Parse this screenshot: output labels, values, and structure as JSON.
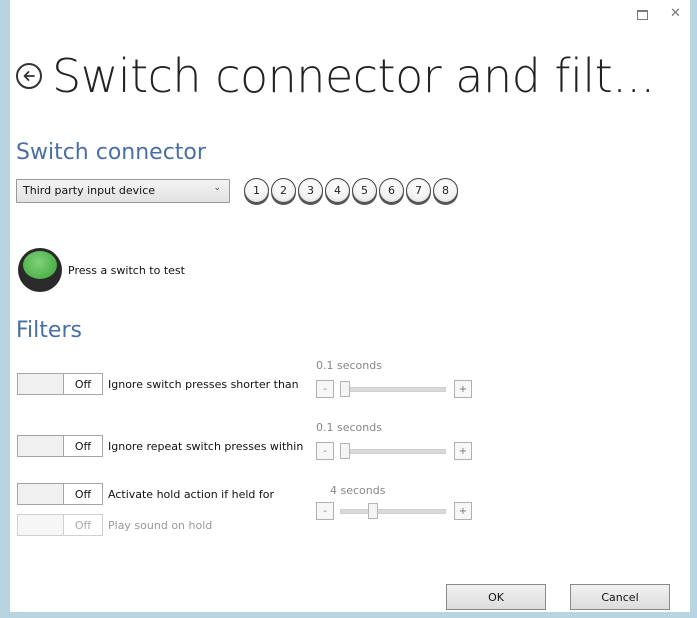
{
  "window": {
    "title": "Switch connector and filt...",
    "controls": {
      "maximize_icon": "maximize-icon",
      "close_icon": "close-icon",
      "close_glyph": "✕"
    }
  },
  "back_icon": "back-arrow-icon",
  "switch_connector": {
    "heading": "Switch connector",
    "device_select": {
      "selected": "Third party input device"
    },
    "numbers": [
      "1",
      "2",
      "3",
      "4",
      "5",
      "6",
      "7",
      "8"
    ],
    "test_label": "Press a switch to test",
    "test_color": "#4eb24a"
  },
  "filters": {
    "heading": "Filters",
    "items": [
      {
        "toggle": "Off",
        "label": "Ignore switch presses shorter than",
        "value_label": "0.1 seconds",
        "minus": "-",
        "plus": "+",
        "slider_fraction": 0.0
      },
      {
        "toggle": "Off",
        "label": "Ignore repeat switch presses within",
        "value_label": "0.1 seconds",
        "minus": "-",
        "plus": "+",
        "slider_fraction": 0.0
      },
      {
        "toggle": "Off",
        "label": "Activate hold action if held for",
        "value_label": "4 seconds",
        "minus": "-",
        "plus": "+",
        "slider_fraction": 0.3
      },
      {
        "toggle": "Off",
        "label": "Play sound on hold",
        "disabled": true
      }
    ]
  },
  "buttons": {
    "ok": "OK",
    "cancel": "Cancel"
  },
  "colors": {
    "heading": "#4a6fa5",
    "frame": "#b8d4e0",
    "test_button": "#4eb24a"
  }
}
